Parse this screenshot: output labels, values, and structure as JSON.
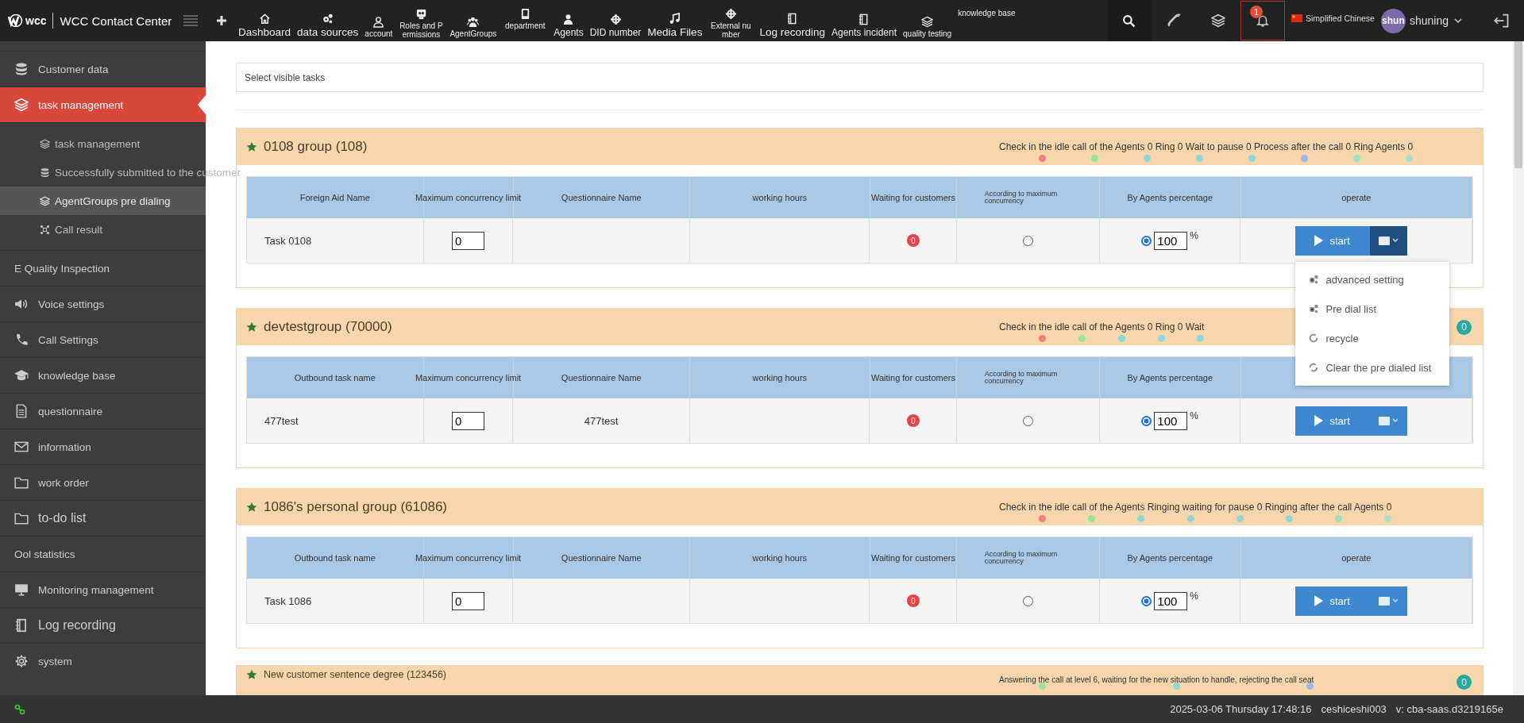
{
  "topbar": {
    "logo": "wcc",
    "title": "WCC Contact Center",
    "nav": [
      {
        "label": "Dashboard"
      },
      {
        "label": "data sources"
      },
      {
        "label": "account"
      },
      {
        "label": "Roles and Permissions"
      },
      {
        "label": "AgentGroups"
      },
      {
        "label": "department"
      },
      {
        "label": "Agents"
      },
      {
        "label": "DID number"
      },
      {
        "label": "Media Files"
      },
      {
        "label": "External number"
      },
      {
        "label": "Log recording"
      },
      {
        "label": "Agents incident"
      },
      {
        "label": "quality testing"
      },
      {
        "label": "knowledge base"
      }
    ],
    "notification_count": "1",
    "language": "Simplified Chinese",
    "avatar": "shun",
    "user": "shuning"
  },
  "sidebar": {
    "items": [
      {
        "label": "Customer data",
        "selected": false
      },
      {
        "label": "task management",
        "selected": true,
        "expanded": true,
        "children": [
          {
            "label": "task management",
            "selected": false
          },
          {
            "label": "Successfully submitted to the customer",
            "selected": false
          },
          {
            "label": "AgentGroups pre dialing",
            "selected": true
          },
          {
            "label": "Call result",
            "selected": false
          }
        ]
      },
      {
        "label": "E Quality Inspection",
        "selected": false
      },
      {
        "label": "Voice settings",
        "selected": false
      },
      {
        "label": "Call Settings",
        "selected": false
      },
      {
        "label": "knowledge base",
        "selected": false
      },
      {
        "label": "questionnaire",
        "selected": false
      },
      {
        "label": "information",
        "selected": false
      },
      {
        "label": "work order",
        "selected": false
      },
      {
        "label": "to-do list",
        "selected": false
      },
      {
        "label": "Ool statistics",
        "selected": false
      },
      {
        "label": "Monitoring management",
        "selected": false
      },
      {
        "label": "Log recording",
        "selected": false
      },
      {
        "label": "system",
        "selected": false
      }
    ]
  },
  "filter": {
    "placeholder": "Select visible tasks"
  },
  "groups": [
    {
      "title": "0108 group (108)",
      "status": "Check in the idle call of the Agents 0 Ring 0 Wait to pause 0 Process after the call 0 Ring Agents 0",
      "dots": [
        {
          "color": "#f08080"
        },
        {
          "color": "#9be39b"
        },
        {
          "color": "#8fd8d8"
        },
        {
          "color": "#8fd8d8"
        },
        {
          "color": "#8fd8d8"
        },
        {
          "color": "#9fb8e8"
        },
        {
          "color": "#9be3c0"
        },
        {
          "color": "#a8e0d0"
        }
      ],
      "columns": [
        "Foreign Aid Name",
        "Maximum concurrency limit",
        "Questionnaire Name",
        "working hours",
        "Waiting for customers",
        "According to maximum concurrency",
        "By Agents percentage",
        "operate"
      ],
      "rows": [
        {
          "name": "Task 0108",
          "max": "0",
          "questionnaire": null,
          "waiting": "0",
          "by_max": {
            "selected": false
          },
          "by_percent": {
            "selected": true
          },
          "percent": "100",
          "unit": "%",
          "action": "start",
          "menu_expanded": true
        }
      ]
    },
    {
      "title": "devtestgroup  (70000)",
      "status": "Check in the idle call of the Agents 0 Ring 0 Wait",
      "badge": "0",
      "dots": [
        {
          "color": "#f08080"
        },
        {
          "color": "#9be39b"
        },
        {
          "color": "#8fd8d8"
        },
        {
          "color": "#8fd8d8"
        },
        {
          "color": "#8fd8d8"
        }
      ],
      "columns": [
        "Outbound task name",
        "Maximum concurrency limit",
        "Questionnaire Name",
        "working hours",
        "Waiting for customers",
        "According to maximum concurrency",
        "By Agents percentage"
      ],
      "rows": [
        {
          "name": "477test",
          "max": "0",
          "questionnaire": "477test",
          "waiting": "0",
          "by_max": {
            "selected": false
          },
          "by_percent": {
            "selected": true
          },
          "percent": "100",
          "unit": "%",
          "action": "start",
          "menu_expanded": false
        }
      ]
    },
    {
      "title": "1086's personal group (61086)",
      "status": "Check in the idle call of the Agents Ringing waiting for pause 0 Ringing after the call Agents 0",
      "dots": [
        {
          "color": "#f08080"
        },
        {
          "color": "#9be39b"
        },
        {
          "color": "#8fd8d8"
        },
        {
          "color": "#8fd8d8"
        },
        {
          "color": "#8fd8d8"
        },
        {
          "color": "#8fd8d8"
        },
        {
          "color": "#9be3c0"
        },
        {
          "color": "#a8e0d0"
        }
      ],
      "columns": [
        "Outbound task name",
        "Maximum concurrency limit",
        "Questionnaire Name",
        "working hours",
        "Waiting for customers",
        "According to maximum concurrency",
        "By Agents percentage",
        "operate"
      ],
      "rows": [
        {
          "name": "Task 1086",
          "max": "0",
          "questionnaire": null,
          "waiting": "0",
          "by_max": {
            "selected": false
          },
          "by_percent": {
            "selected": true
          },
          "percent": "100",
          "unit": "%",
          "action": "start",
          "menu_expanded": false
        }
      ]
    },
    {
      "title": "New customer sentence degree (123456)",
      "status": "Answering the call at level 6, waiting for the new situation to handle, rejecting the call seat",
      "badge": "0",
      "dots": [
        {
          "color": "#9be39b"
        },
        {
          "color": "#8fd8d8"
        },
        {
          "color": "#9fb8e8"
        }
      ]
    }
  ],
  "row_menu": [
    {
      "label": "advanced setting"
    },
    {
      "label": "Pre dial list"
    },
    {
      "label": "recycle"
    },
    {
      "label": "Clear the pre dialed list"
    }
  ],
  "status_bar": {
    "datetime": "2025-03-06 Thursday 17:48:16",
    "user": "ceshiceshi003",
    "version": "v: cba-saas.d3219165e"
  }
}
